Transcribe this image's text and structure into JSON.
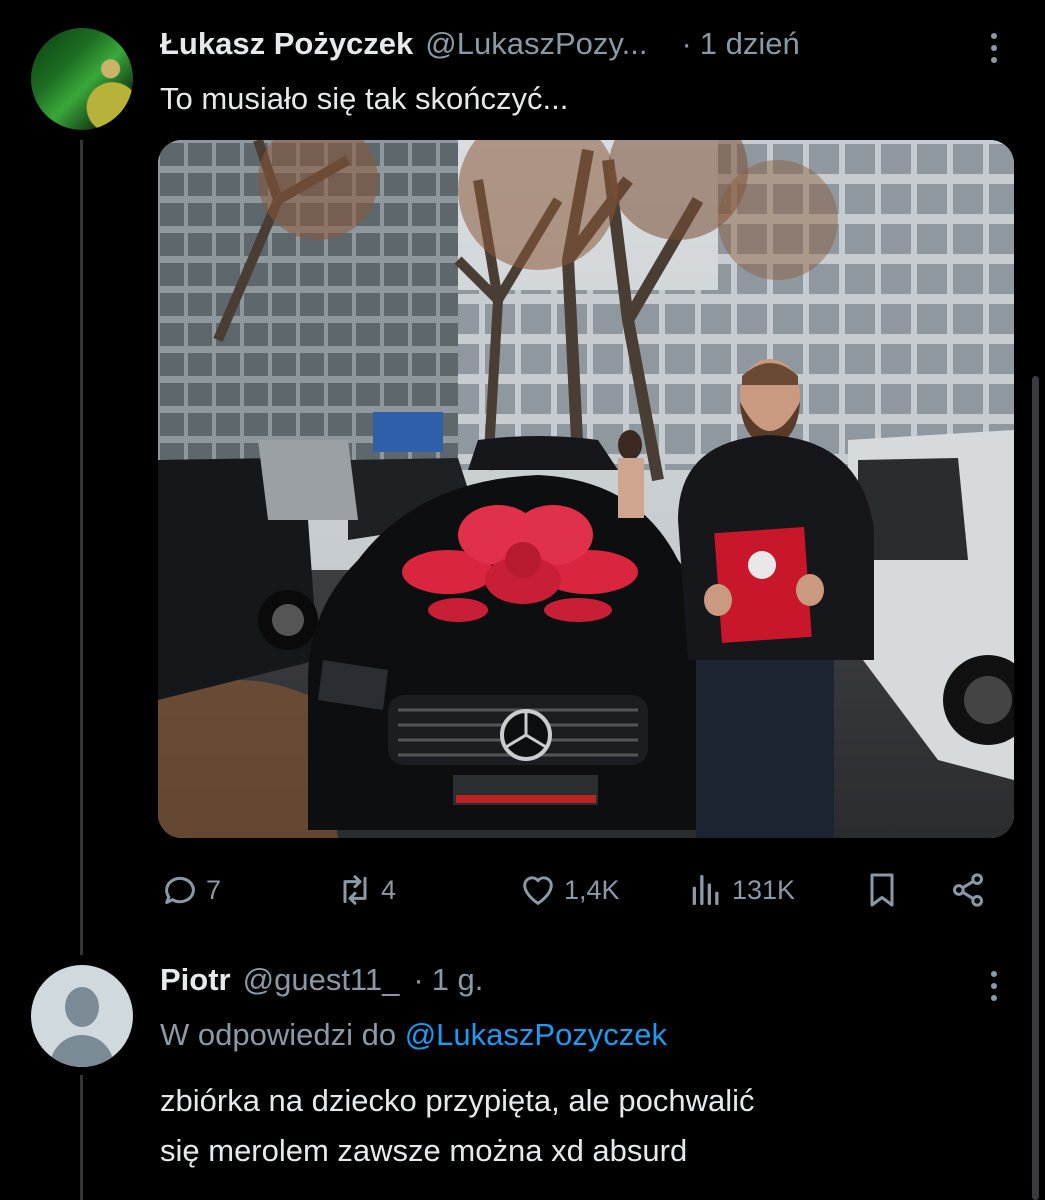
{
  "tweet": {
    "author_name": "Łukasz Pożyczek",
    "author_handle": "@LukaszPozy...",
    "separator": "·",
    "time": "1 dzień",
    "text": "To musiało się tak skończyć...",
    "stats": {
      "replies": "7",
      "retweets": "4",
      "likes": "1,4K",
      "views": "131K"
    }
  },
  "reply": {
    "author_name": "Piotr",
    "author_handle": "@guest11_",
    "separator": "·",
    "time": "1 g.",
    "reply_to_prefix": "W odpowiedzi do",
    "reply_to_handle": "@LukaszPozyczek",
    "text_line1": "zbiórka na dziecko przypięta, ale pochwalić",
    "text_line2": "się merolem zawsze można xd absurd"
  },
  "colors": {
    "background": "#000000",
    "text": "#e7e9ea",
    "secondary": "#8b98a5",
    "accent": "#1d9bf0"
  }
}
